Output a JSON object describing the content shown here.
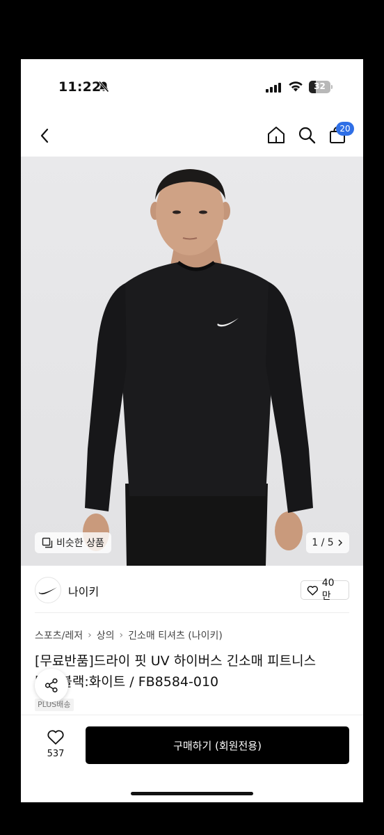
{
  "status_bar": {
    "time": "11:22",
    "battery": "32",
    "battery_level": 0.32
  },
  "nav": {
    "cart_count": "20"
  },
  "gallery": {
    "similar_label": "비슷한 상품",
    "page": "1 / 5"
  },
  "brand": {
    "name": "나이키",
    "like_count": "40만"
  },
  "breadcrumb": [
    "스포츠/레저",
    "상의",
    "긴소매 티셔츠 (나이키)"
  ],
  "product": {
    "title_line1": "[무료반품]드라이 핏 UV 하이버스 긴소매 피트니스",
    "title_line2": "탑 - 블랙:화이트 / FB8584-010",
    "tag": "PLUS배송"
  },
  "bottom": {
    "wish_count": "537",
    "buy_label": "구매하기 (회원전용)"
  },
  "colors": {
    "accent": "#2f6fe6",
    "buy_button": "#000000"
  }
}
